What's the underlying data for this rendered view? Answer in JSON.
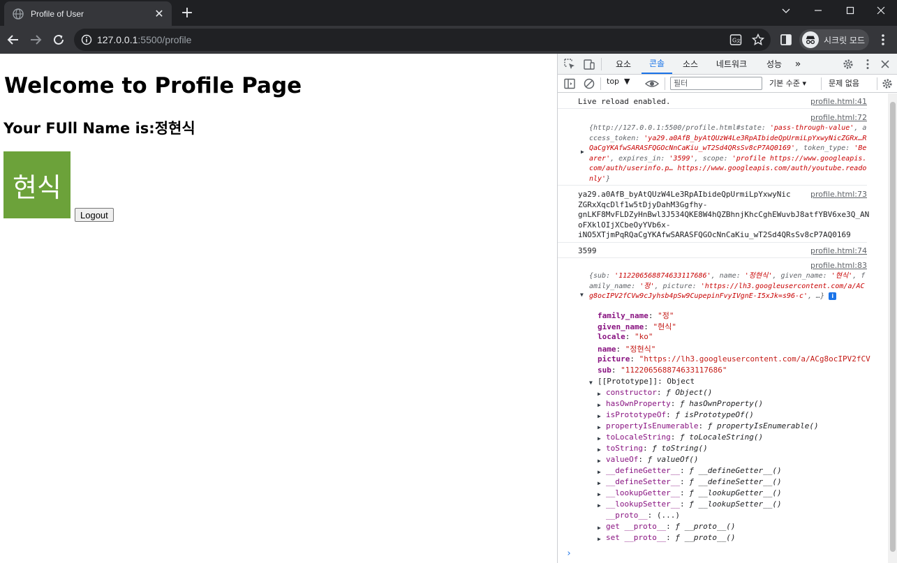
{
  "browser": {
    "tab_title": "Profile of User",
    "url_host": "127.0.0.1",
    "url_rest": ":5500/profile",
    "profile_label": "시크릿 모드"
  },
  "page": {
    "heading": "Welcome to Profile Page",
    "subheading": "Your FUll Name is:정현식",
    "avatar_text": "현식",
    "avatar_color": "#6ca23a",
    "logout_label": "Logout"
  },
  "devtools": {
    "tabs": [
      "요소",
      "콘솔",
      "소스",
      "네트워크",
      "성능"
    ],
    "active_tab": "콘솔",
    "context": "top",
    "filter_placeholder": "필터",
    "levels": "기본 수준",
    "issues": "문제 없음",
    "messages": {
      "live_reload": {
        "text": "Live reload enabled.",
        "source": "profile.html:41"
      },
      "state_obj": {
        "source": "profile.html:72",
        "k1": "{http://127.0.0.1:5500/profile.html#state: ",
        "v1": "'pass-through-value'",
        "k2": ", access_token: ",
        "v2": "'ya29.a0AfB_byAtQUzW4Le3RpAIbideQpUrmiLpYxwyNicZGRx…RQaCgYKAfwSARASFQGOcNnCaKiu_wT2Sd4QRsSv8cP7AQ0169'",
        "k3": ", token_type: ",
        "v3": "'Bearer'",
        "k4": ", expires_in: ",
        "v4": "'3599'",
        "k5": ", scope: ",
        "v5": "'profile https://www.googleapis.com/auth/userinfo.p… https://www.googleapis.com/auth/youtube.readonly'",
        "k6": "}"
      },
      "token": {
        "source": "profile.html:73",
        "lines": [
          "ya29.a0AfB_byAtQUzW4Le3RpAIbideQpUrmiLpYxwyNic",
          "ZGRxXqcDlf1w5tDjyDahM3Ggfhy-",
          "gnLKF8MvFLDZyHnBwl3J534QKE8W4hQZBhnjKhcCghEWuvbJ8atfYBV6xe3Q_AN",
          "oFXklOIjXCbeOyYVb6x-",
          "iNO5XTjmPqRQaCgYKAfwSARASFQGOcNnCaKiu_wT2Sd4QRsSv8cP7AQ0169"
        ]
      },
      "expires": {
        "text": "3599",
        "source": "profile.html:74"
      },
      "user_obj": {
        "source": "profile.html:83",
        "k1": "{sub: ",
        "v1": "'112206568874633117686'",
        "k2": ", name: ",
        "v2": "'정현식'",
        "k3": ", given_name: ",
        "v3": "'현식'",
        "k4": ", family_name: ",
        "v4": "'정'",
        "k5": ", picture: ",
        "v5": "'https://lh3.googleusercontent.com/a/ACg8ocIPV2fCVw9cJyhsb4pSw9CupepinFvyIVgnE-I5xJk=s96-c'",
        "k6": ", …}",
        "info": "i",
        "props": [
          {
            "key": "family_name",
            "value": "\"정\""
          },
          {
            "key": "given_name",
            "value": "\"현식\""
          },
          {
            "key": "locale",
            "value": "\"ko\""
          },
          {
            "key": "name",
            "value": "\"정현식\""
          },
          {
            "key": "picture",
            "value": "\"https://lh3.googleusercontent.com/a/ACg8ocIPV2fCV"
          },
          {
            "key": "sub",
            "value": "\"112206568874633117686\""
          }
        ],
        "prototype_label": "[[Prototype]]: Object",
        "proto_items": [
          {
            "key": "constructor",
            "value": "ƒ Object()"
          },
          {
            "key": "hasOwnProperty",
            "value": "ƒ hasOwnProperty()"
          },
          {
            "key": "isPrototypeOf",
            "value": "ƒ isPrototypeOf()"
          },
          {
            "key": "propertyIsEnumerable",
            "value": "ƒ propertyIsEnumerable()"
          },
          {
            "key": "toLocaleString",
            "value": "ƒ toLocaleString()"
          },
          {
            "key": "toString",
            "value": "ƒ toString()"
          },
          {
            "key": "valueOf",
            "value": "ƒ valueOf()"
          },
          {
            "key": "__defineGetter__",
            "value": "ƒ __defineGetter__()"
          },
          {
            "key": "__defineSetter__",
            "value": "ƒ __defineSetter__()"
          },
          {
            "key": "__lookupGetter__",
            "value": "ƒ __lookupGetter__()"
          },
          {
            "key": "__lookupSetter__",
            "value": "ƒ __lookupSetter__()"
          },
          {
            "key": "__proto__",
            "value": "(...)"
          },
          {
            "key": "get __proto__",
            "value": "ƒ __proto__()"
          },
          {
            "key": "set __proto__",
            "value": "ƒ __proto__()"
          }
        ]
      }
    },
    "prompt": "›"
  }
}
